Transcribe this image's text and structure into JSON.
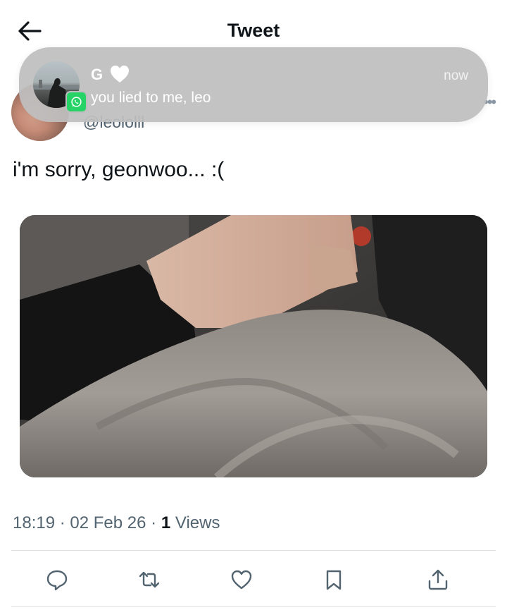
{
  "header": {
    "title": "Tweet",
    "back_icon": "arrow-left-icon"
  },
  "tweet": {
    "author_handle": "@leololll",
    "text": "i'm sorry, geonwoo... :(",
    "time": "18:19",
    "date": "02 Feb 26",
    "views_count": "1",
    "views_label": "Views",
    "separator": "·"
  },
  "actions": {
    "reply": "reply-icon",
    "retweet": "retweet-icon",
    "like": "heart-outline-icon",
    "bookmark": "bookmark-icon",
    "share": "share-icon"
  },
  "notification": {
    "sender": "G",
    "body": "you lied to me, leo",
    "time": "now",
    "app": "WhatsApp",
    "app_color": "#25d366"
  },
  "colors": {
    "text": "#0f1419",
    "secondary": "#536471",
    "divider": "#dfe3e6"
  }
}
